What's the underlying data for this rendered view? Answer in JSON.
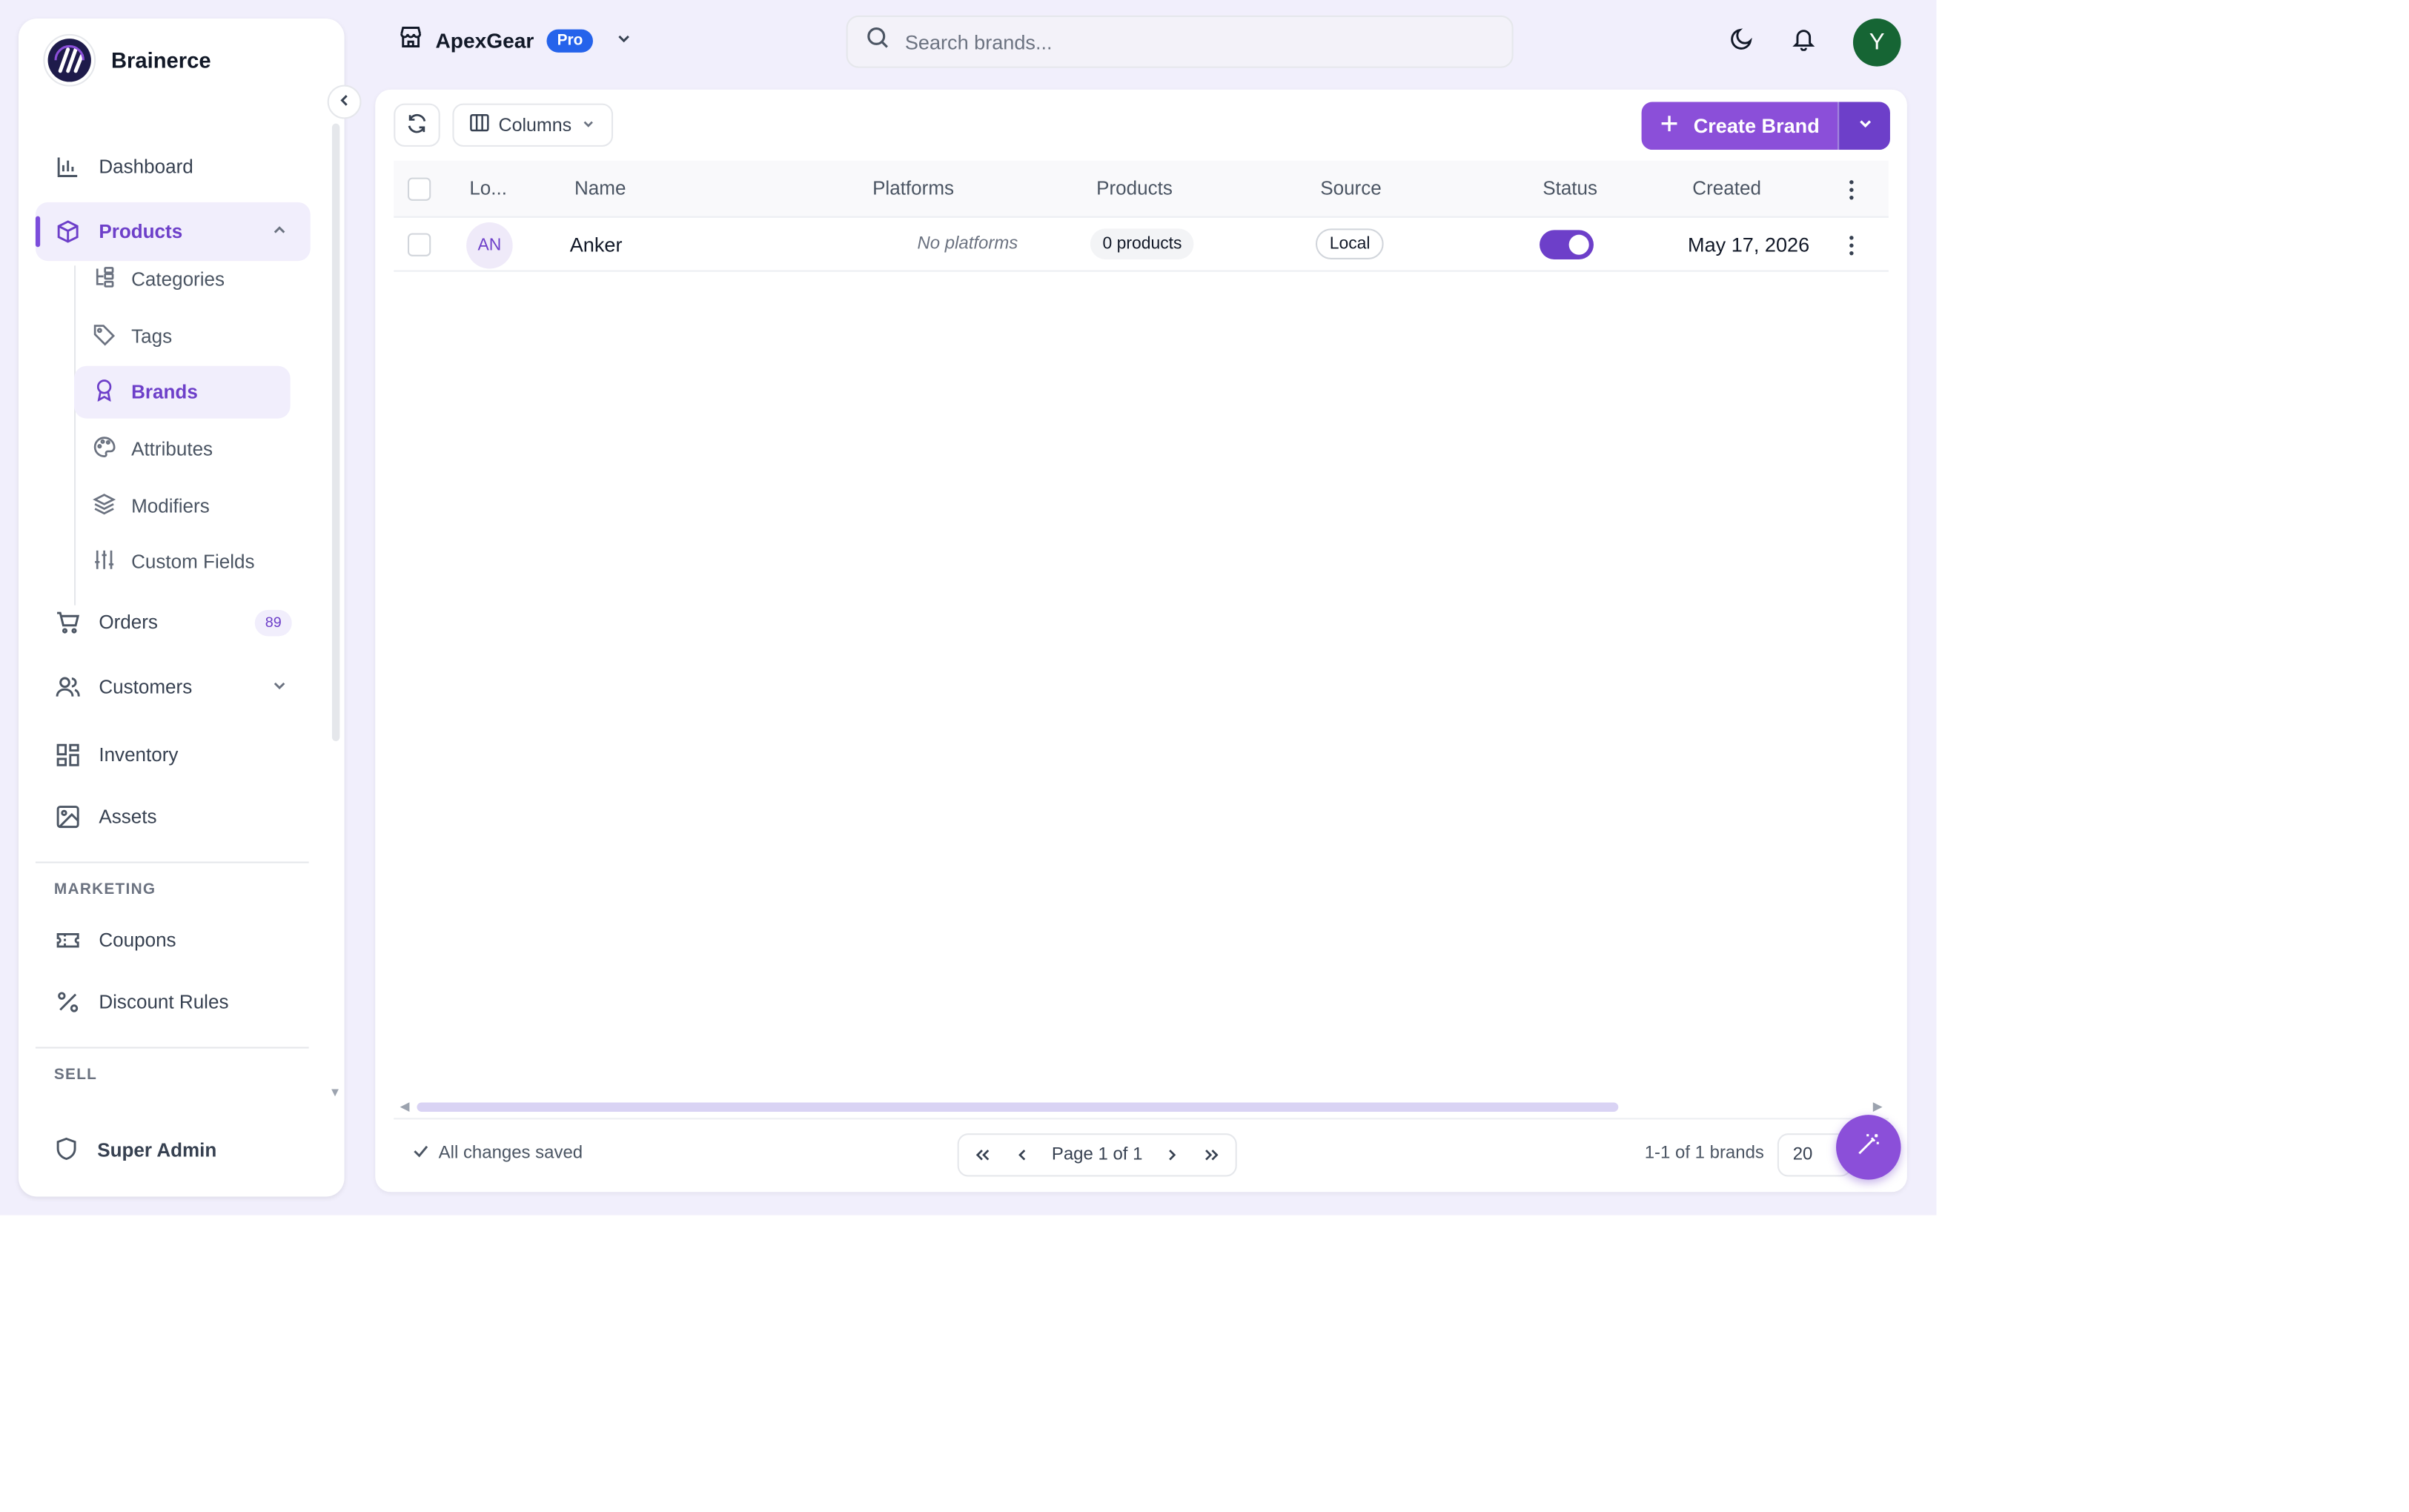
{
  "app": {
    "name": "Brainerce"
  },
  "sidebar": {
    "items": [
      {
        "label": "Dashboard",
        "icon": "bar-chart-icon"
      },
      {
        "label": "Products",
        "icon": "package-icon",
        "active": true,
        "expanded": true
      },
      {
        "label": "Orders",
        "icon": "cart-icon",
        "badge": "89"
      },
      {
        "label": "Customers",
        "icon": "users-icon"
      },
      {
        "label": "Inventory",
        "icon": "grid-icon"
      },
      {
        "label": "Assets",
        "icon": "image-icon"
      }
    ],
    "products_sub": [
      {
        "label": "Categories",
        "icon": "tree-icon"
      },
      {
        "label": "Tags",
        "icon": "tag-icon"
      },
      {
        "label": "Brands",
        "icon": "award-icon",
        "active": true
      },
      {
        "label": "Attributes",
        "icon": "palette-icon"
      },
      {
        "label": "Modifiers",
        "icon": "layers-icon"
      },
      {
        "label": "Custom Fields",
        "icon": "sliders-icon"
      }
    ],
    "marketing_label": "MARKETING",
    "marketing": [
      {
        "label": "Coupons",
        "icon": "ticket-icon"
      },
      {
        "label": "Discount Rules",
        "icon": "percent-icon"
      }
    ],
    "sell_label": "SELL",
    "footer_user": "Super Admin"
  },
  "topbar": {
    "store_name": "ApexGear",
    "plan_badge": "Pro",
    "search_placeholder": "Search brands...",
    "avatar_initial": "Y"
  },
  "toolbar": {
    "columns_label": "Columns",
    "create_label": "Create Brand"
  },
  "table": {
    "columns": [
      "Lo...",
      "Name",
      "Platforms",
      "Products",
      "Source",
      "Status",
      "Created"
    ],
    "rows": [
      {
        "logo_initials": "AN",
        "name": "Anker",
        "platforms": "No platforms",
        "products": "0 products",
        "source": "Local",
        "status_enabled": true,
        "created": "May 17, 2026"
      }
    ]
  },
  "footer": {
    "saved_text": "All changes saved",
    "page_text": "Page 1 of 1",
    "count_text": "1-1 of 1 brands",
    "page_size": "20"
  },
  "colors": {
    "accent": "#8b4fd9",
    "accent_dark": "#6d3fc9",
    "background": "#f1effc",
    "pro_badge": "#2563eb",
    "avatar": "#166534"
  }
}
